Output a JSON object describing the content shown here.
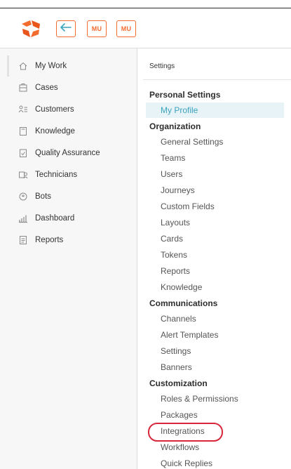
{
  "header": {
    "logo": "logo-icon",
    "back_icon": "arrow-left-icon",
    "user_badges": [
      "MU",
      "MU"
    ],
    "accent_color": "#f26b2f"
  },
  "sidebar": {
    "items": [
      {
        "label": "My Work",
        "icon": "home-icon"
      },
      {
        "label": "Cases",
        "icon": "cases-icon"
      },
      {
        "label": "Customers",
        "icon": "customers-icon"
      },
      {
        "label": "Knowledge",
        "icon": "book-icon"
      },
      {
        "label": "Quality Assurance",
        "icon": "clipboard-check-icon"
      },
      {
        "label": "Technicians",
        "icon": "technicians-icon"
      },
      {
        "label": "Bots",
        "icon": "bot-icon"
      },
      {
        "label": "Dashboard",
        "icon": "bar-chart-icon"
      },
      {
        "label": "Reports",
        "icon": "report-icon"
      }
    ]
  },
  "settings": {
    "title": "Settings",
    "sections": [
      {
        "heading": "Personal Settings",
        "items": [
          "My Profile"
        ]
      },
      {
        "heading": "Organization",
        "items": [
          "General Settings",
          "Teams",
          "Users",
          "Journeys",
          "Custom Fields",
          "Layouts",
          "Cards",
          "Tokens",
          "Reports",
          "Knowledge"
        ]
      },
      {
        "heading": "Communications",
        "items": [
          "Channels",
          "Alert Templates",
          "Settings",
          "Banners"
        ]
      },
      {
        "heading": "Customization",
        "items": [
          "Roles & Permissions",
          "Packages",
          "Integrations",
          "Workflows",
          "Quick Replies"
        ]
      }
    ],
    "selected_item": "My Profile",
    "highlighted_item": "Integrations",
    "selected_color": "#3aa3bd",
    "highlight_color": "#d8263c"
  }
}
